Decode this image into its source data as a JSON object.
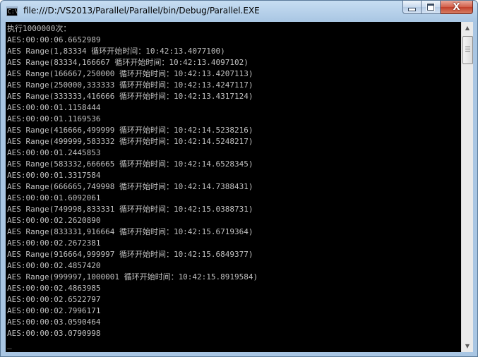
{
  "window": {
    "title": "file:///D:/VS2013/Parallel/Parallel/bin/Debug/Parallel.EXE",
    "buttons": {
      "minimize": "minimize",
      "maximize": "maximize",
      "close": "X"
    }
  },
  "console": {
    "lines": [
      "执行1000000次：",
      "AES:00:00:06.6652989",
      "AES Range(1,83334 循环开始时间：10:42:13.4077100)",
      "AES Range(83334,166667 循环开始时间：10:42:13.4097102)",
      "AES Range(166667,250000 循环开始时间：10:42:13.4207113)",
      "AES Range(250000,333333 循环开始时间：10:42:13.4247117)",
      "AES Range(333333,416666 循环开始时间：10:42:13.4317124)",
      "AES:00:00:01.1158444",
      "AES:00:00:01.1169536",
      "AES Range(416666,499999 循环开始时间：10:42:14.5238216)",
      "AES Range(499999,583332 循环开始时间：10:42:14.5248217)",
      "AES:00:00:01.2445853",
      "AES Range(583332,666665 循环开始时间：10:42:14.6528345)",
      "AES:00:00:01.3317584",
      "AES Range(666665,749998 循环开始时间：10:42:14.7388431)",
      "AES:00:00:01.6092061",
      "AES Range(749998,833331 循环开始时间：10:42:15.0388731)",
      "AES:00:00:02.2620890",
      "AES Range(833331,916664 循环开始时间：10:42:15.6719364)",
      "AES:00:00:02.2672381",
      "AES Range(916664,999997 循环开始时间：10:42:15.6849377)",
      "AES:00:00:02.4857420",
      "AES Range(999997,1000001 循环开始时间：10:42:15.8919584)",
      "AES:00:00:02.4863985",
      "AES:00:00:02.6522797",
      "AES:00:00:02.7996171",
      "AES:00:00:03.0590464",
      "AES:00:00:03.0790998",
      "_"
    ]
  },
  "scrollbar": {
    "up_icon": "▲",
    "down_icon": "▼"
  },
  "colors": {
    "console_bg": "#000000",
    "console_text": "#c0c0c0",
    "titlebar": "#a9c6e3",
    "close_button": "#c2402b"
  }
}
